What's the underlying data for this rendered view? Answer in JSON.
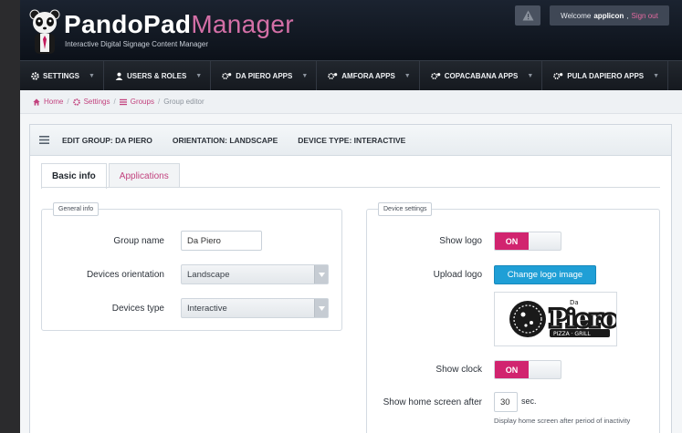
{
  "header": {
    "brand_bold": "PandoPad",
    "brand_light": "Manager",
    "subtitle": "Interactive Digital Signage Content Manager",
    "welcome_prefix": "Welcome",
    "username": "applicon",
    "signout": "Sign out",
    "colors": {
      "brand_accent": "#d36fa6",
      "header_bg": "#111822"
    }
  },
  "nav": {
    "items": [
      {
        "label": "SETTINGS",
        "icon": "gear-icon"
      },
      {
        "label": "USERS & ROLES",
        "icon": "user-icon"
      },
      {
        "label": "DA PIERO APPS",
        "icon": "cogs-icon"
      },
      {
        "label": "AMFORA APPS",
        "icon": "cogs-icon"
      },
      {
        "label": "COPACABANA APPS",
        "icon": "cogs-icon"
      },
      {
        "label": "PULA DAPIERO APPS",
        "icon": "cogs-icon"
      }
    ]
  },
  "breadcrumb": {
    "home": "Home",
    "settings": "Settings",
    "groups": "Groups",
    "current": "Group editor"
  },
  "panel": {
    "edit_group": "EDIT GROUP: DA PIERO",
    "orientation": "ORIENTATION: LANDSCAPE",
    "device_type": "DEVICE TYPE: INTERACTIVE"
  },
  "tabs": {
    "basic_info": "Basic info",
    "applications": "Applications"
  },
  "general_info": {
    "legend": "General info",
    "group_name_label": "Group name",
    "group_name_value": "Da Piero",
    "orientation_label": "Devices orientation",
    "orientation_value": "Landscape",
    "type_label": "Devices type",
    "type_value": "Interactive"
  },
  "device_settings": {
    "legend": "Device settings",
    "show_logo_label": "Show logo",
    "show_logo_state": "ON",
    "upload_logo_label": "Upload logo",
    "change_logo_button": "Change logo image",
    "logo_text_main": "Piero",
    "logo_text_top": "Da",
    "logo_text_bottom": "PIZZA · GRILL",
    "show_clock_label": "Show clock",
    "show_clock_state": "ON",
    "home_screen_label": "Show home screen after",
    "home_screen_value": "30",
    "home_screen_unit": "sec.",
    "home_screen_help": "Display home screen after period of inactivity",
    "colors": {
      "toggle_on": "#d1246f",
      "button_blue": "#1f9fd6"
    }
  }
}
